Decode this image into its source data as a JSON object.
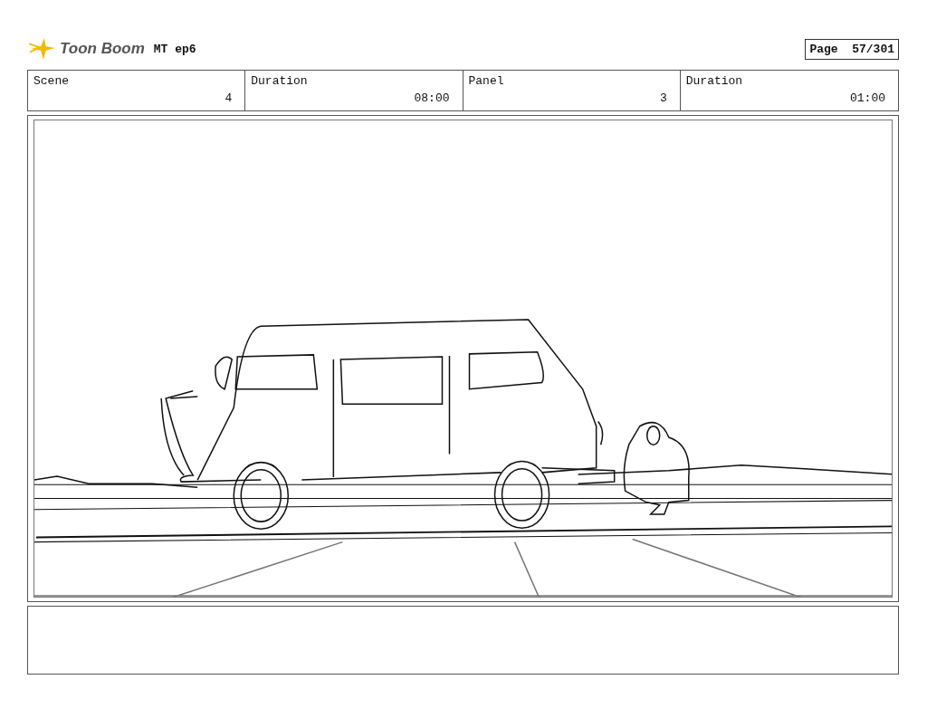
{
  "header": {
    "logo_text": "Toon Boom",
    "title": "MT ep6",
    "page": "Page  57/301"
  },
  "fields": [
    {
      "label": "Scene",
      "value": "4"
    },
    {
      "label": "Duration",
      "value": "08:00"
    },
    {
      "label": "Panel",
      "value": "3"
    },
    {
      "label": "Duration",
      "value": "01:00"
    }
  ]
}
